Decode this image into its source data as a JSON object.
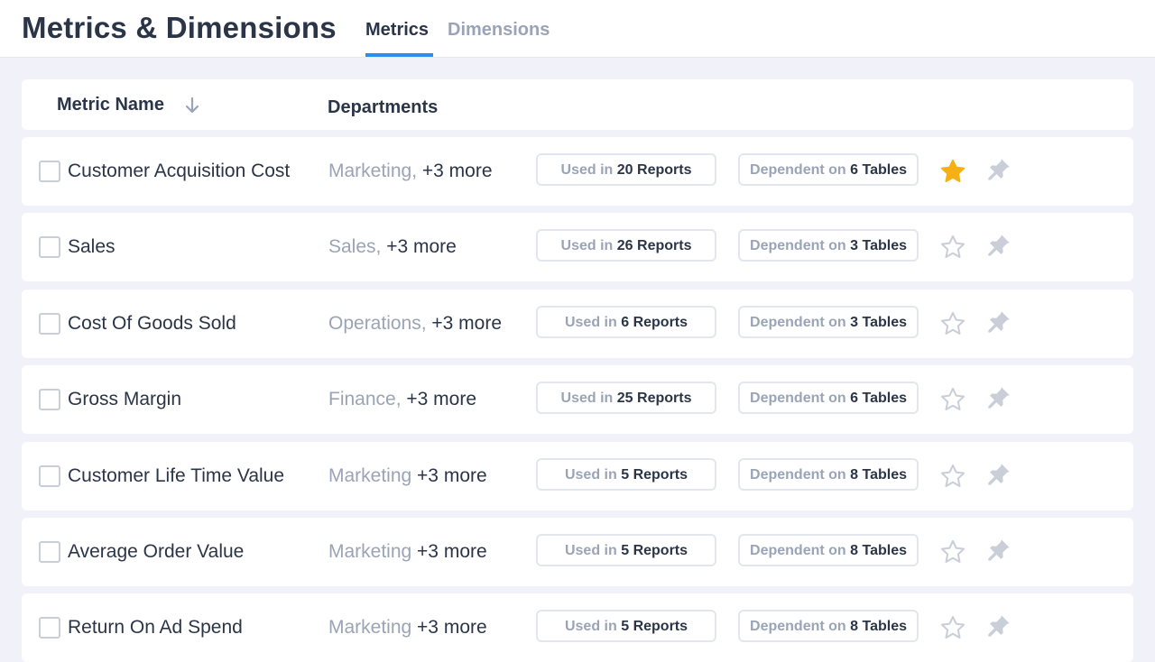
{
  "header": {
    "title": "Metrics & Dimensions",
    "tabs": [
      {
        "label": "Metrics",
        "active": true
      },
      {
        "label": "Dimensions",
        "active": false
      }
    ]
  },
  "table": {
    "columns": {
      "name": "Metric Name",
      "departments": "Departments"
    },
    "used_prefix": "Used in",
    "dependent_prefix": "Dependent on",
    "rows": [
      {
        "name": "Customer Acquisition Cost",
        "department": "Marketing,",
        "more": "+3 more",
        "reports": "20 Reports",
        "tables": "6 Tables",
        "starred": true
      },
      {
        "name": "Sales",
        "department": "Sales,",
        "more": "+3 more",
        "reports": "26 Reports",
        "tables": "3 Tables",
        "starred": false
      },
      {
        "name": "Cost Of Goods Sold",
        "department": "Operations,",
        "more": "+3 more",
        "reports": "6 Reports",
        "tables": "3 Tables",
        "starred": false
      },
      {
        "name": "Gross Margin",
        "department": "Finance,",
        "more": "+3 more",
        "reports": "25 Reports",
        "tables": "6 Tables",
        "starred": false
      },
      {
        "name": "Customer Life Time Value",
        "department": "Marketing",
        "more": "+3 more",
        "reports": "5 Reports",
        "tables": "8 Tables",
        "starred": false
      },
      {
        "name": "Average Order Value",
        "department": "Marketing",
        "more": "+3 more",
        "reports": "5 Reports",
        "tables": "8 Tables",
        "starred": false
      },
      {
        "name": "Return On Ad Spend",
        "department": "Marketing",
        "more": "+3 more",
        "reports": "5 Reports",
        "tables": "8 Tables",
        "starred": false
      }
    ]
  },
  "colors": {
    "accent": "#2d8cf0",
    "star_active": "#f5b014",
    "star_inactive": "#c9ced8",
    "pin": "#c9ced8",
    "text_primary": "#2b3548",
    "text_muted": "#9aa4b6"
  }
}
